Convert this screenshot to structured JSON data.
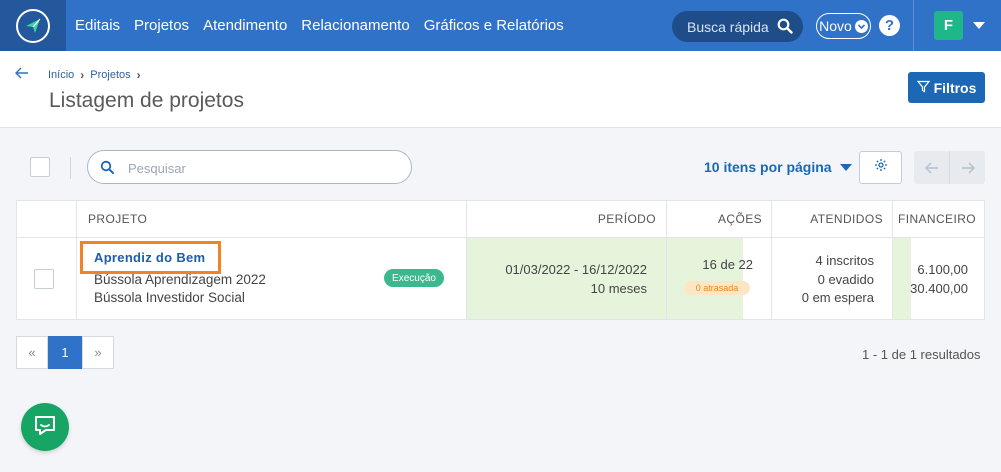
{
  "nav": {
    "items": [
      "Editais",
      "Projetos",
      "Atendimento",
      "Relacionamento",
      "Gráficos e Relatórios"
    ],
    "search_label": "Busca rápida",
    "novo_label": "Novo",
    "help_label": "?",
    "avatar_letter": "F"
  },
  "breadcrumb": {
    "items": [
      "Início",
      "Projetos"
    ]
  },
  "page": {
    "title": "Listagem de projetos",
    "filters_label": "Filtros"
  },
  "toolbar": {
    "search_placeholder": "Pesquisar",
    "per_page_label": "10 itens por página"
  },
  "table": {
    "headers": [
      "PROJETO",
      "PERÍODO",
      "AÇÕES",
      "ATENDIDOS",
      "FINANCEIRO"
    ],
    "rows": [
      {
        "project_name": "Aprendiz do Bem",
        "project_line2": "Bússola Aprendizagem 2022",
        "project_line3": "Bússola Investidor Social",
        "status": "Execução",
        "period": "01/03/2022 - 16/12/2022",
        "duration": "10 meses",
        "actions": "16 de 22",
        "late": "0 atrasada",
        "attended_1": "4 inscritos",
        "attended_2": "0 evadido",
        "attended_3": "0 em espera",
        "finance_1": "6.100,00",
        "finance_2": "30.400,00"
      }
    ]
  },
  "pagination": {
    "prev": "«",
    "current": "1",
    "next": "»",
    "results": "1 - 1 de 1 resultados"
  },
  "colors": {
    "primary": "#2f72c8",
    "dark": "#24589d",
    "accent": "#1c68b5",
    "highlight": "#f08324",
    "success": "#3cb88f",
    "progress": "#e6f4dc"
  },
  "icons": [
    "logo-icon",
    "search-icon",
    "chevron-down-icon",
    "help-icon",
    "back-arrow-icon",
    "filter-icon",
    "gear-icon",
    "arrow-left-icon",
    "arrow-right-icon",
    "chat-icon"
  ]
}
